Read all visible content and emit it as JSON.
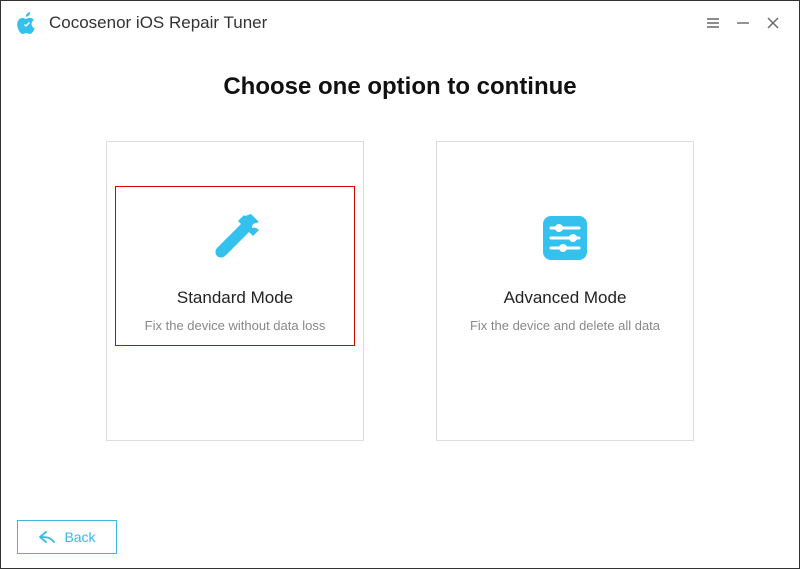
{
  "titlebar": {
    "title": "Cocosenor iOS Repair Tuner"
  },
  "main": {
    "heading": "Choose one option to continue",
    "cards": [
      {
        "name": "Standard Mode",
        "desc": "Fix the device without data loss"
      },
      {
        "name": "Advanced Mode",
        "desc": "Fix the device and delete all data"
      }
    ]
  },
  "footer": {
    "back_label": "Back"
  },
  "colors": {
    "accent": "#35c1ee",
    "highlight": "#d40000"
  }
}
